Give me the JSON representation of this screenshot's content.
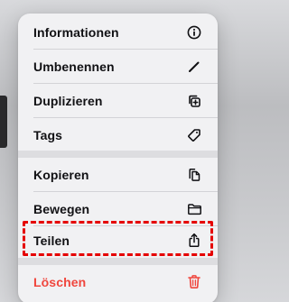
{
  "menu": {
    "items": [
      {
        "label": "Informationen",
        "icon": "info-circle-icon"
      },
      {
        "label": "Umbenennen",
        "icon": "pencil-icon"
      },
      {
        "label": "Duplizieren",
        "icon": "duplicate-icon"
      },
      {
        "label": "Tags",
        "icon": "tag-icon"
      },
      {
        "label": "Kopieren",
        "icon": "copy-document-icon"
      },
      {
        "label": "Bewegen",
        "icon": "folder-icon"
      },
      {
        "label": "Teilen",
        "icon": "share-icon"
      },
      {
        "label": "Löschen",
        "icon": "trash-icon"
      }
    ],
    "highlighted_item": "Teilen",
    "colors": {
      "text": "#111114",
      "danger": "#f0463d",
      "highlight_border": "#e50000",
      "menu_background": "#f1f1f3"
    }
  }
}
